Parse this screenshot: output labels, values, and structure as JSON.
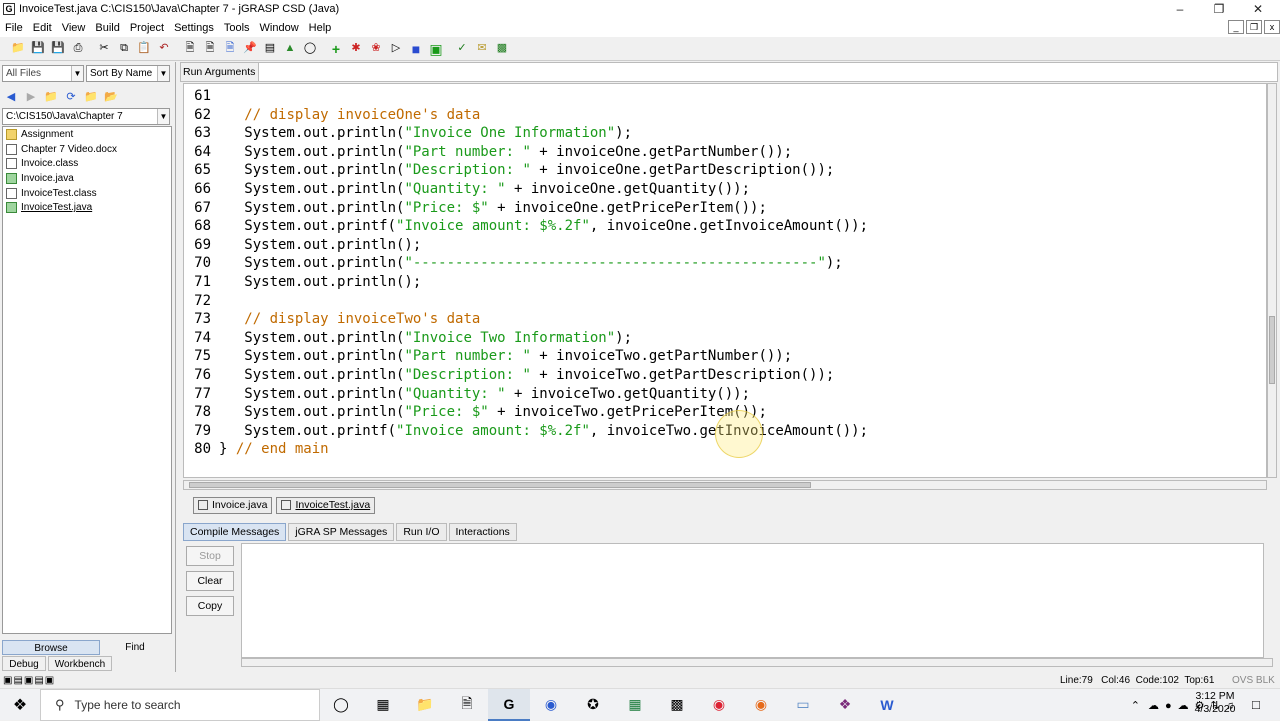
{
  "window": {
    "title": "InvoiceTest.java  C:\\CIS150\\Java\\Chapter 7 - jGRASP CSD (Java)",
    "app_icon": "G"
  },
  "menu": [
    "File",
    "Edit",
    "View",
    "Build",
    "Project",
    "Settings",
    "Tools",
    "Window",
    "Help"
  ],
  "toolbar_icons": [
    "open-folder-icon",
    "save-icon",
    "save-all-icon",
    "print-icon",
    "cut-icon",
    "copy-icon",
    "paste-icon",
    "undo-icon",
    "new-file-icon",
    "new-file2-icon",
    "new-file3-icon",
    "pin-icon",
    "csd-icon",
    "structure-icon",
    "shield-icon",
    "compile-icon",
    "run-icon",
    "debug-icon",
    "step-icon",
    "square-blue-icon",
    "green-panel-icon",
    "check-icon",
    "envelope-icon",
    "workbench-icon"
  ],
  "left": {
    "filter": "All Files",
    "sort": "Sort By Name",
    "path": "C:\\CIS150\\Java\\Chapter 7",
    "files": [
      {
        "name": "Assignment",
        "kind": "folder"
      },
      {
        "name": "Chapter 7 Video.docx",
        "kind": "doc"
      },
      {
        "name": "Invoice.class",
        "kind": "doc"
      },
      {
        "name": "Invoice.java",
        "kind": "java"
      },
      {
        "name": "InvoiceTest.class",
        "kind": "doc"
      },
      {
        "name": "InvoiceTest.java",
        "kind": "java"
      }
    ],
    "browse": "Browse",
    "find": "Find",
    "debug": "Debug",
    "workbench": "Workbench"
  },
  "run_arguments_label": "Run Arguments",
  "code_lines": [
    {
      "n": "61",
      "t": ""
    },
    {
      "n": "62",
      "t": "   // display invoiceOne's data"
    },
    {
      "n": "63",
      "t": "   System.out.println(\"Invoice One Information\");"
    },
    {
      "n": "64",
      "t": "   System.out.println(\"Part number: \" + invoiceOne.getPartNumber());"
    },
    {
      "n": "65",
      "t": "   System.out.println(\"Description: \" + invoiceOne.getPartDescription());"
    },
    {
      "n": "66",
      "t": "   System.out.println(\"Quantity: \" + invoiceOne.getQuantity());"
    },
    {
      "n": "67",
      "t": "   System.out.println(\"Price: $\" + invoiceOne.getPricePerItem());"
    },
    {
      "n": "68",
      "t": "   System.out.printf(\"Invoice amount: $%.2f\", invoiceOne.getInvoiceAmount());"
    },
    {
      "n": "69",
      "t": "   System.out.println();"
    },
    {
      "n": "70",
      "t": "   System.out.println(\"------------------------------------------------\");"
    },
    {
      "n": "71",
      "t": "   System.out.println();"
    },
    {
      "n": "72",
      "t": ""
    },
    {
      "n": "73",
      "t": "   // display invoiceTwo's data"
    },
    {
      "n": "74",
      "t": "   System.out.println(\"Invoice Two Information\");"
    },
    {
      "n": "75",
      "t": "   System.out.println(\"Part number: \" + invoiceTwo.getPartNumber());"
    },
    {
      "n": "76",
      "t": "   System.out.println(\"Description: \" + invoiceTwo.getPartDescription());"
    },
    {
      "n": "77",
      "t": "   System.out.println(\"Quantity: \" + invoiceTwo.getQuantity());"
    },
    {
      "n": "78",
      "t": "   System.out.println(\"Price: $\" + invoiceTwo.getPricePerItem());"
    },
    {
      "n": "79",
      "t": "   System.out.printf(\"Invoice amount: $%.2f\", invoiceTwo.getInvoiceAmount());"
    },
    {
      "n": "80",
      "t": "} // end main"
    }
  ],
  "file_tabs": [
    "Invoice.java",
    "InvoiceTest.java"
  ],
  "message_tabs": [
    "Compile Messages",
    "jGRA SP Messages",
    "Run I/O",
    "Interactions"
  ],
  "message_buttons": {
    "stop": "Stop",
    "clear": "Clear",
    "copy": "Copy"
  },
  "status": "Line:79   Col:46  Code:102  Top:61",
  "status_ovs": "OVS BLK",
  "taskbar": {
    "search_placeholder": "Type here to search",
    "time": "3:12 PM",
    "date": "4/3/2020"
  },
  "colors": {
    "string": "#1a9a1a",
    "comment": "#c06a00",
    "accent": "#4a7cc4"
  }
}
